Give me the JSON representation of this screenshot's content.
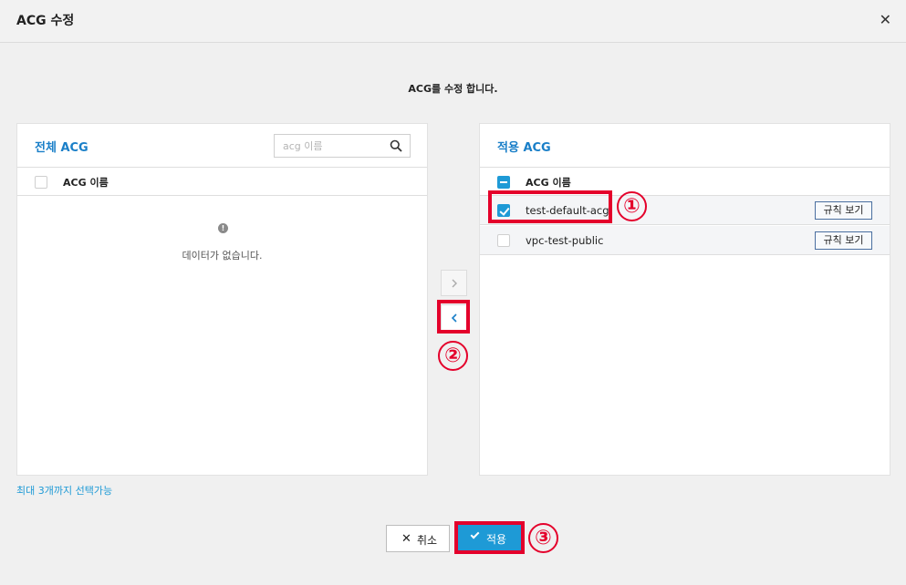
{
  "header": {
    "title": "ACG 수정",
    "close_icon": "close-icon"
  },
  "subtitle": "ACG를 수정 합니다.",
  "left_panel": {
    "title": "전체 ACG",
    "search_placeholder": "acg 이름",
    "column_header": "ACG 이름",
    "empty_text": "데이터가 없습니다.",
    "empty_icon_glyph": "!"
  },
  "right_panel": {
    "title": "적용 ACG",
    "column_header": "ACG 이름",
    "rows": [
      {
        "name": "test-default-acg",
        "checked": true,
        "rule_button": "규칙 보기"
      },
      {
        "name": "vpc-test-public",
        "checked": false,
        "rule_button": "규칙 보기"
      }
    ]
  },
  "move_buttons": {
    "add_icon": "chevron-right-icon",
    "remove_icon": "chevron-left-icon"
  },
  "note": "최대 3개까지 선택가능",
  "footer": {
    "cancel_label": "취소",
    "apply_label": "적용"
  },
  "annotations": {
    "callout_1": "①",
    "callout_2": "②",
    "callout_3": "③",
    "color": "#e4002b"
  },
  "colors": {
    "accent": "#1e9ad6",
    "title_blue": "#1a7fc8"
  }
}
